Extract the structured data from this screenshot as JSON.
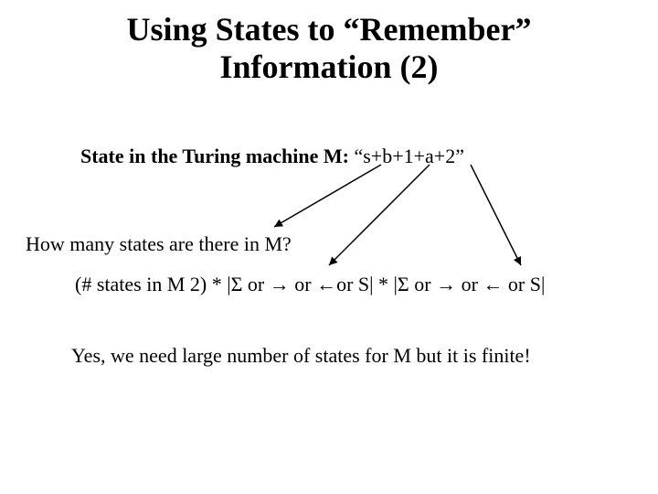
{
  "title_line1": "Using States to “Remember”",
  "title_line2": "Information (2)",
  "state_label": "State in the Turing machine M: ",
  "state_value": "“s+b+1+a+2”",
  "question": "How many states are there in M?",
  "formula": "(# states in M 2) * |Σ or → or ←or S| * |Σ or → or ← or S|",
  "conclusion": "Yes, we need large number of states for M but it is finite!"
}
